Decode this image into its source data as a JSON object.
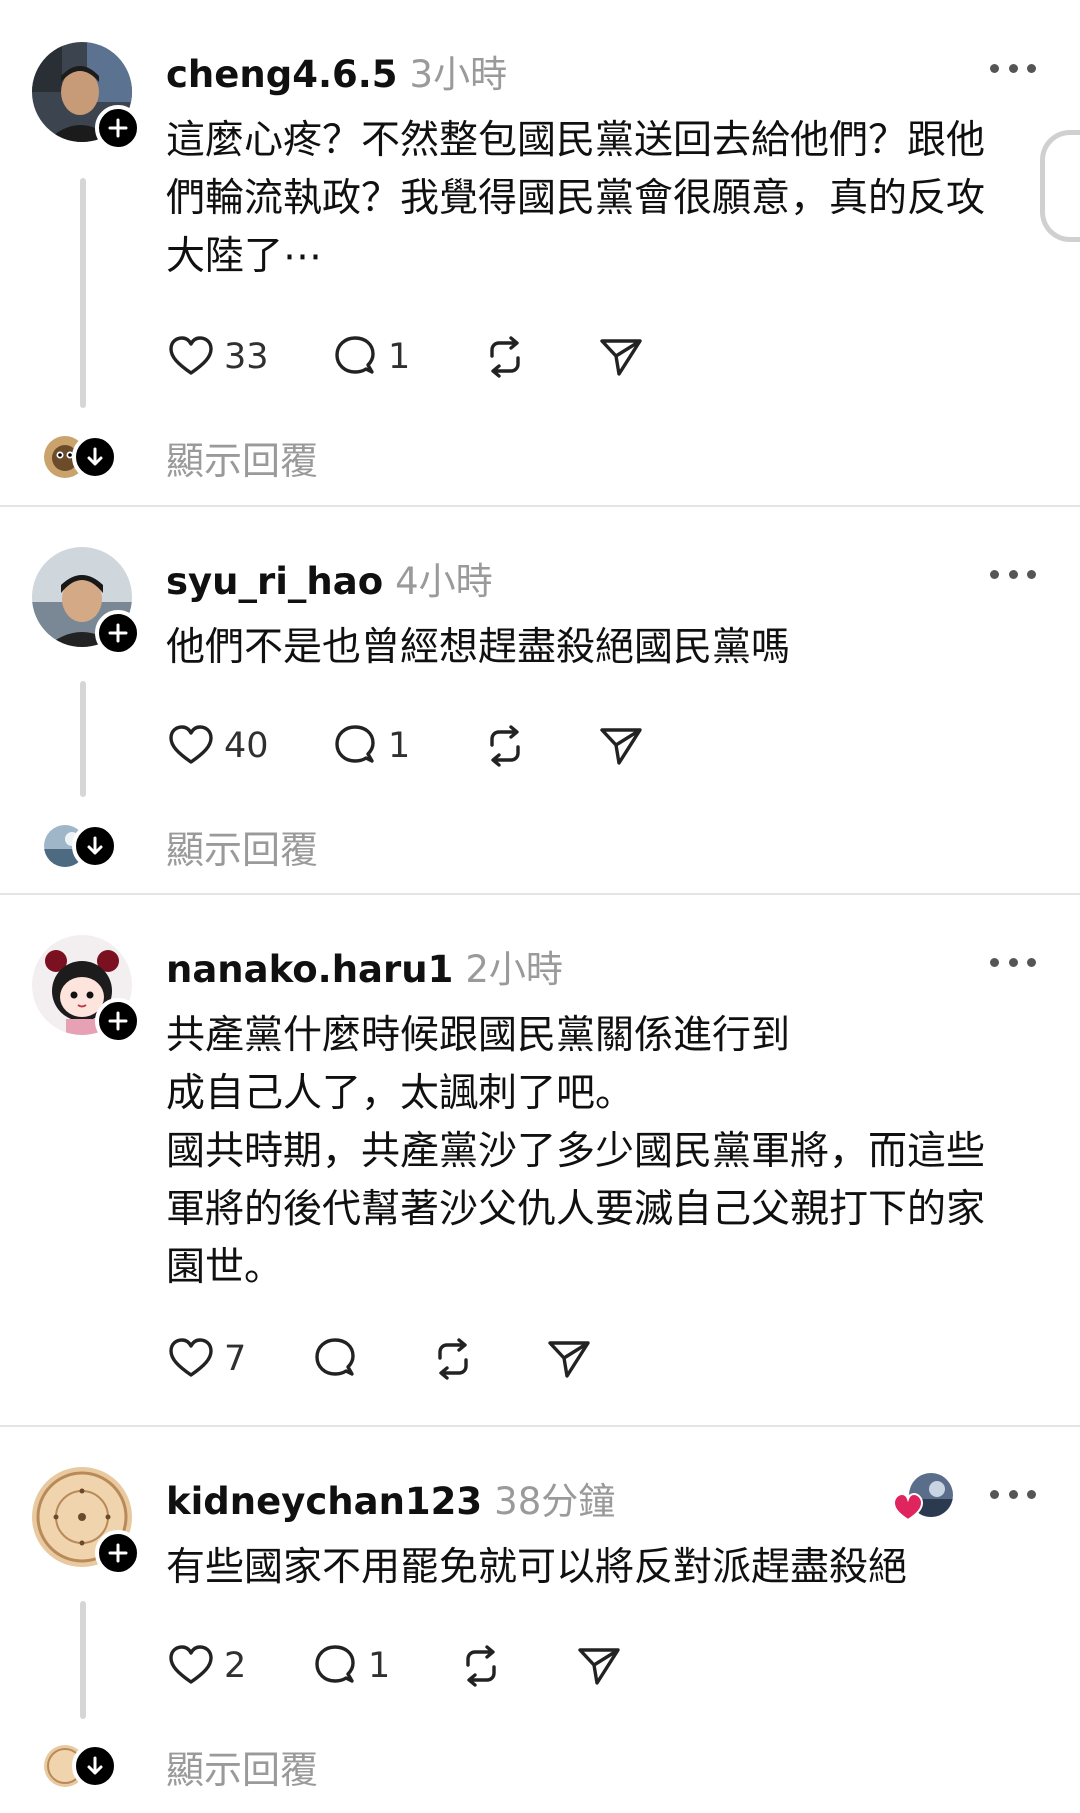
{
  "posts": [
    {
      "username": "cheng4.6.5",
      "time": "3小時",
      "text": "這麼心疼？不然整包國民黨送回去給他們？跟他\n們輪流執政？我覺得國民黨會很願意，真的反攻\n大陸了⋯",
      "likes": "33",
      "comments": "1",
      "show_replies": "顯示回覆"
    },
    {
      "username": "syu_ri_hao",
      "time": "4小時",
      "text": "他們不是也曾經想趕盡殺絕國民黨嗎",
      "likes": "40",
      "comments": "1",
      "show_replies": "顯示回覆"
    },
    {
      "username": "nanako.haru1",
      "time": "2小時",
      "text": "共產黨什麼時候跟國民黨關係進行到\n成自己人了，太諷刺了吧。\n國共時期，共產黨沙了多少國民黨軍將，而這些\n軍將的後代幫著沙父仇人要滅自己父親打下的家\n園世。",
      "likes": "7",
      "comments": ""
    },
    {
      "username": "kidneychan123",
      "time": "38分鐘",
      "text": "有些國家不用罷免就可以將反對派趕盡殺絕",
      "likes": "2",
      "comments": "1",
      "show_replies": "顯示回覆"
    }
  ],
  "icons": {
    "follow": "plus-icon",
    "more": "more-dots-icon",
    "like": "heart-outline-icon",
    "comment": "comment-bubble-icon",
    "repost": "repost-icon",
    "share": "send-icon",
    "expand": "arrow-down-icon"
  },
  "colors": {
    "text": "#101010",
    "muted": "#9a9a9a",
    "divider": "#e4e4e4",
    "liked_heart": "#e0245e"
  }
}
